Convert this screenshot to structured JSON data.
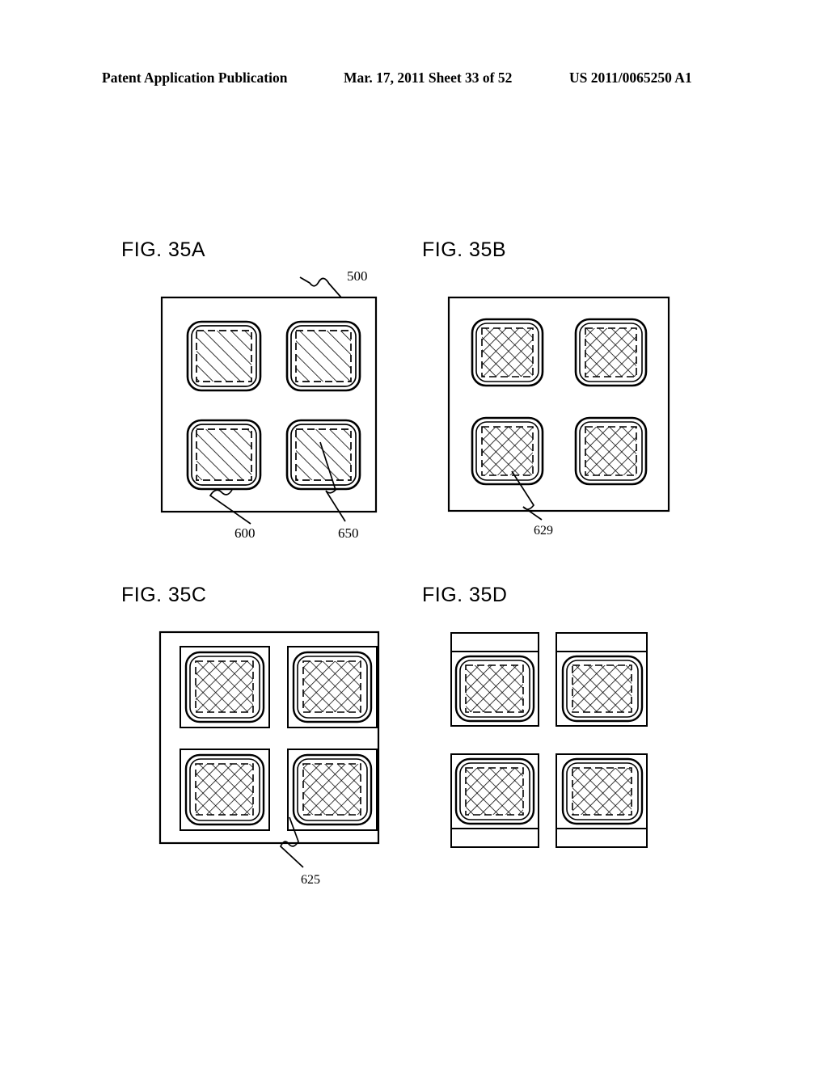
{
  "header": {
    "publication": "Patent Application Publication",
    "date_sheet": "Mar. 17, 2011  Sheet 33 of 52",
    "document_number": "US 2011/0065250 A1"
  },
  "figures": [
    {
      "id": "fig-35a",
      "title": "FIG. 35A",
      "hatch": "single",
      "cell_style": "rounded",
      "outer_frame": true,
      "labels": [
        {
          "text": "500",
          "name": "reference-500"
        },
        {
          "text": "600",
          "name": "reference-600"
        },
        {
          "text": "650",
          "name": "reference-650"
        }
      ]
    },
    {
      "id": "fig-35b",
      "title": "FIG. 35B",
      "hatch": "cross",
      "cell_style": "rounded",
      "outer_frame": true,
      "labels": [
        {
          "text": "629",
          "name": "reference-629"
        }
      ]
    },
    {
      "id": "fig-35c",
      "title": "FIG. 35C",
      "hatch": "cross",
      "cell_style": "framed",
      "outer_frame": true,
      "labels": [
        {
          "text": "625",
          "name": "reference-625"
        }
      ]
    },
    {
      "id": "fig-35d",
      "title": "FIG. 35D",
      "hatch": "cross",
      "cell_style": "separated-strip",
      "outer_frame": false,
      "labels": []
    }
  ],
  "drawing": {
    "line_color": "#000000",
    "background": "#ffffff",
    "cell_count_per_figure": 4,
    "cell_grid": "2x2"
  }
}
